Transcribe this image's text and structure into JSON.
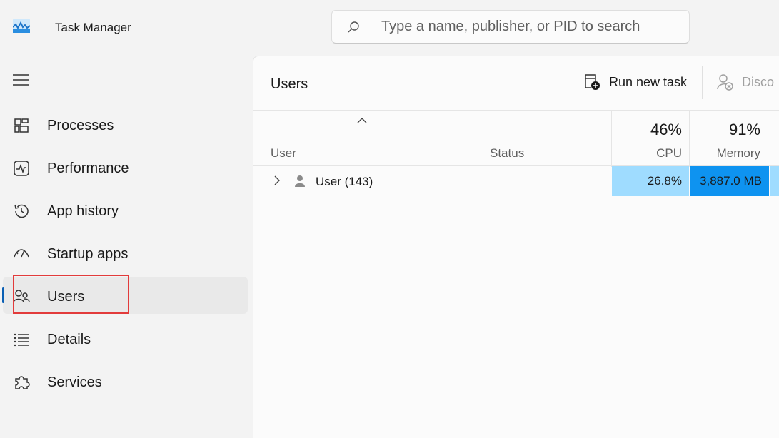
{
  "app": {
    "title": "Task Manager"
  },
  "search": {
    "placeholder": "Type a name, publisher, or PID to search"
  },
  "sidebar": {
    "items": [
      {
        "id": "processes",
        "label": "Processes"
      },
      {
        "id": "performance",
        "label": "Performance"
      },
      {
        "id": "app-history",
        "label": "App history"
      },
      {
        "id": "startup-apps",
        "label": "Startup apps"
      },
      {
        "id": "users",
        "label": "Users"
      },
      {
        "id": "details",
        "label": "Details"
      },
      {
        "id": "services",
        "label": "Services"
      }
    ],
    "active": "users"
  },
  "main": {
    "title": "Users",
    "toolbar": {
      "run_new_task": "Run new task",
      "disconnect": "Disco"
    },
    "columns": {
      "user": "User",
      "status": "Status",
      "cpu": {
        "label": "CPU",
        "percent": "46%"
      },
      "memory": {
        "label": "Memory",
        "percent": "91%"
      }
    },
    "rows": [
      {
        "user": "User (143)",
        "status": "",
        "cpu": "26.8%",
        "memory": "3,887.0 MB"
      }
    ]
  },
  "colors": {
    "accent": "#0a5fb4",
    "cpu_heat": "#9fdcff",
    "mem_heat": "#0e93f0",
    "highlight": "#e23b3b"
  }
}
